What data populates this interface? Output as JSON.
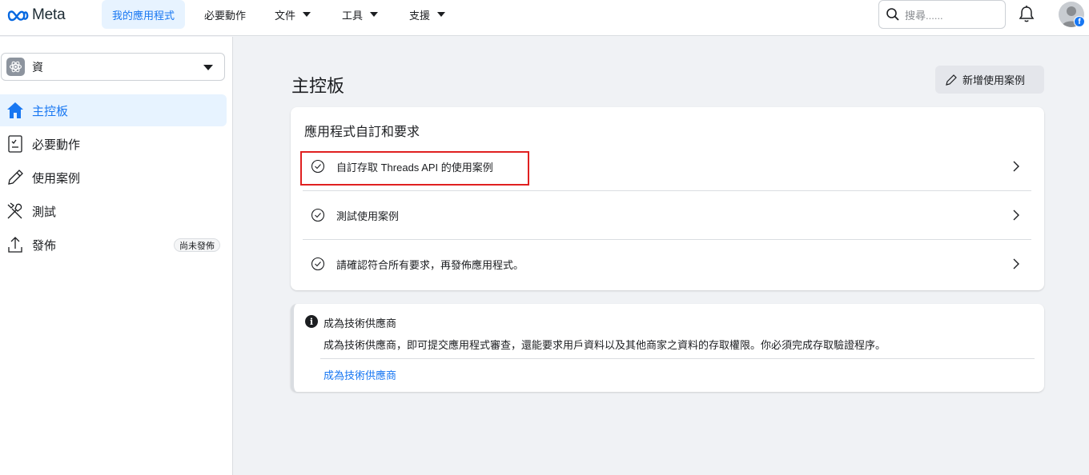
{
  "topbar": {
    "brand": "Meta",
    "nav": [
      {
        "label": "我的應用程式",
        "active": true
      },
      {
        "label": "必要動作",
        "dropdown": false
      },
      {
        "label": "文件",
        "dropdown": true
      },
      {
        "label": "工具",
        "dropdown": true
      },
      {
        "label": "支援",
        "dropdown": true
      }
    ],
    "search_placeholder": "搜尋......"
  },
  "sidebar": {
    "app_name": "資",
    "items": [
      {
        "label": "主控板",
        "icon": "home-icon",
        "active": true
      },
      {
        "label": "必要動作",
        "icon": "clipboard-check-icon"
      },
      {
        "label": "使用案例",
        "icon": "pencil-icon"
      },
      {
        "label": "測試",
        "icon": "tools-icon"
      },
      {
        "label": "發佈",
        "icon": "upload-icon",
        "badge": "尚未發佈"
      }
    ]
  },
  "main": {
    "title": "主控板",
    "add_button": "新增使用案例",
    "card": {
      "title": "應用程式自訂和要求",
      "rows": [
        {
          "label": "自訂存取 Threads API 的使用案例"
        },
        {
          "label": "測試使用案例"
        },
        {
          "label": "請確認符合所有要求，再發佈應用程式。"
        }
      ]
    },
    "info": {
      "title": "成為技術供應商",
      "description": "成為技術供應商，即可提交應用程式審查，還能要求用戶資料以及其他商家之資料的存取權限。你必須完成存取驗證程序。",
      "link": "成為技術供應商"
    }
  },
  "colors": {
    "accent": "#1877f2",
    "highlight_border": "#e02020",
    "background": "#f0f2f5"
  }
}
